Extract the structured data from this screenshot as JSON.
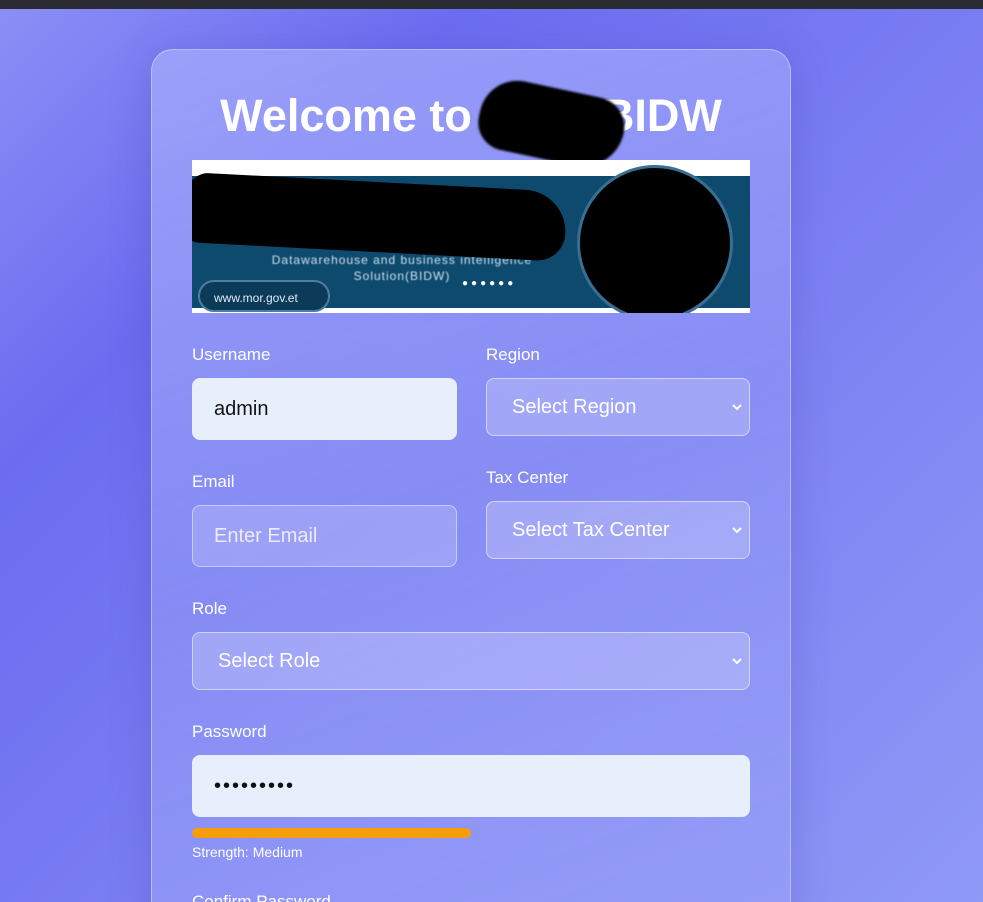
{
  "window": {
    "title": "Welcome to MOR BIDW"
  },
  "page": {
    "title": "Welcome to MOR BIDW",
    "banner": {
      "line": "Datawarehouse and business intelligence Solution(BIDW)",
      "url": "www.mor.gov.et",
      "dots": "●●●●●●"
    }
  },
  "form": {
    "username": {
      "label": "Username",
      "value": "admin"
    },
    "region": {
      "label": "Region",
      "selected": "Select Region"
    },
    "email": {
      "label": "Email",
      "placeholder": "Enter Email"
    },
    "tax_center": {
      "label": "Tax Center",
      "selected": "Select Tax Center"
    },
    "role": {
      "label": "Role",
      "selected": "Select Role"
    },
    "password": {
      "label": "Password",
      "value": "•••••••••",
      "strength_text": "Strength: Medium",
      "strength_fraction": 0.5,
      "strength_color": "#f59e0b"
    },
    "confirm_password": {
      "label": "Confirm Password"
    }
  },
  "colors": {
    "background_start": "#8b8ff5",
    "background_mid": "#6b6cf0",
    "input_filled": "#e8effc",
    "banner_blue": "#0d4a6e"
  },
  "icons": {
    "select_chevron": "chevron-down-icon"
  }
}
